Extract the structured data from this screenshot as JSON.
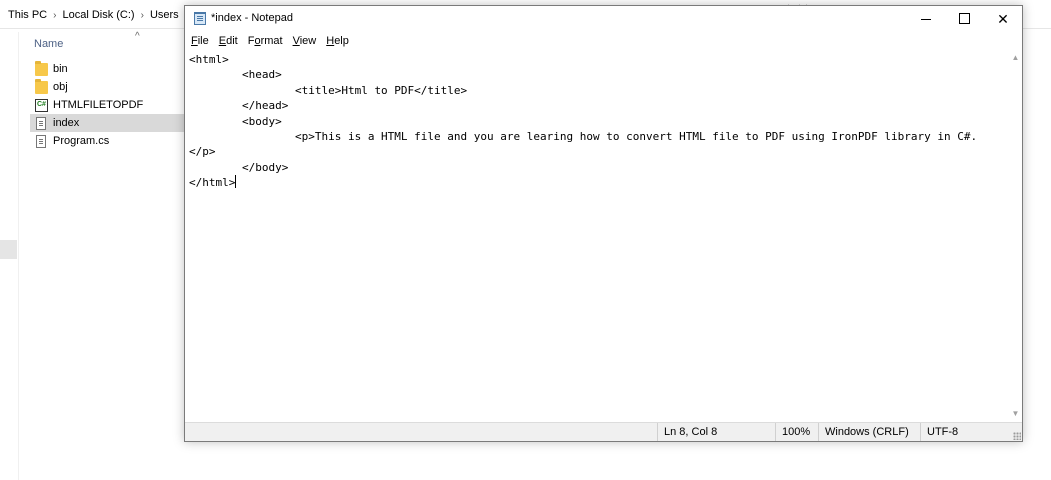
{
  "explorer": {
    "breadcrumb": [
      "This PC",
      "Local Disk (C:)",
      "Users"
    ],
    "separator": "›",
    "column_header": "Name",
    "sort_arrow": "^",
    "files": [
      {
        "name": "bin",
        "icon": "folder-icon"
      },
      {
        "name": "obj",
        "icon": "folder-icon"
      },
      {
        "name": "HTMLFILETOPDF",
        "icon": "csharp-project-icon"
      },
      {
        "name": "index",
        "icon": "text-document-icon",
        "selected": true
      },
      {
        "name": "Program.cs",
        "icon": "csharp-file-icon"
      }
    ]
  },
  "notepad": {
    "title": "*index - Notepad",
    "menu": [
      "File",
      "Edit",
      "Format",
      "View",
      "Help"
    ],
    "menu_mnemonics": [
      "F",
      "E",
      "o",
      "V",
      "H"
    ],
    "content": "<html>\n\t<head>\n\t\t<title>Html to PDF</title>\n\t</head>\n\t<body>\n\t\t<p>This is a HTML file and you are learing how to convert HTML file to PDF using IronPDF library in C#.\n</p>\n\t</body>\n</html>",
    "status": {
      "position": "Ln 8, Col 8",
      "zoom": "100%",
      "line_ending": "Windows (CRLF)",
      "encoding": "UTF-8"
    },
    "buttons": {
      "minimize": "minimize",
      "maximize": "maximize",
      "close": "✕"
    }
  }
}
